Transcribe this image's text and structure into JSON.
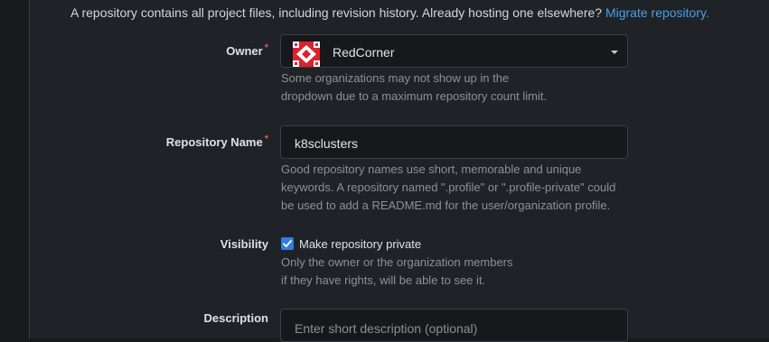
{
  "intro": {
    "text": "A repository contains all project files, including revision history. Already hosting one elsewhere?",
    "link": "Migrate repository."
  },
  "owner": {
    "label": "Owner",
    "required_mark": "*",
    "selected": "RedCorner",
    "help_line1": "Some organizations may not show up in the",
    "help_line2": "dropdown due to a maximum repository count limit.",
    "logo_color": "#d9232e"
  },
  "repo_name": {
    "label": "Repository Name",
    "required_mark": "*",
    "value": "k8sclusters",
    "help_line1": "Good repository names use short, memorable and unique",
    "help_line2": "keywords. A repository named \".profile\" or \".profile-private\" could",
    "help_line3": "be used to add a README.md for the user/organization profile."
  },
  "visibility": {
    "label": "Visibility",
    "checkbox_label": "Make repository private",
    "checked": true,
    "help_line1": "Only the owner or the organization members",
    "help_line2": "if they have rights, will be able to see it."
  },
  "description": {
    "label": "Description",
    "placeholder": "Enter short description (optional)",
    "value": ""
  },
  "colors": {
    "background": "#181a1e",
    "panel": "#1f2226",
    "link": "#4a9fe8",
    "required": "#e0564a",
    "checkbox": "#2f7fe0"
  }
}
